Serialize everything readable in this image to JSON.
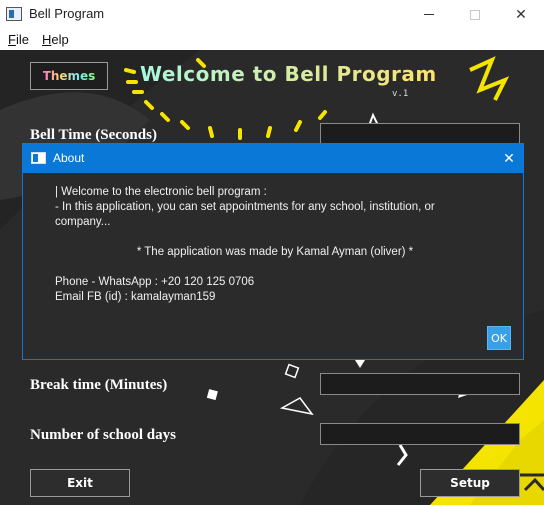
{
  "window": {
    "title": "Bell Program",
    "min_icon": "minimize-icon",
    "max_icon": "maximize-icon",
    "close_icon": "close-icon",
    "close_glyph": "✕"
  },
  "menu": {
    "file": {
      "mnemonic": "F",
      "rest": "ile"
    },
    "help": {
      "mnemonic": "H",
      "rest": "elp"
    }
  },
  "main": {
    "themes_label": "Themes",
    "welcome": "Welcome to Bell Program",
    "version": "v.1",
    "fields": {
      "bell_time": "Bell Time (Seconds)",
      "break_time": "Break time (Minutes)",
      "school_days": "Number of school days"
    },
    "exit_label": "Exit",
    "setup_label": "Setup"
  },
  "about": {
    "title": "About",
    "close_glyph": "✕",
    "lines": {
      "l1": "| Welcome to the electronic bell program :",
      "l2": "- In this application, you can set appointments for any school, institution, or",
      "l3": "company...",
      "l4": "* The application was made by Kamal Ayman (oliver) *",
      "l5": "Phone - WhatsApp : +20 120 125 0706",
      "l6": "Email FB (id) : kamalayman159"
    },
    "ok_label": "OK"
  },
  "colors": {
    "accent": "#0a78d7",
    "ok_button": "#39a0e8",
    "canvas_bg": "#2a2a2a",
    "decor_yellow": "#f5e400"
  }
}
